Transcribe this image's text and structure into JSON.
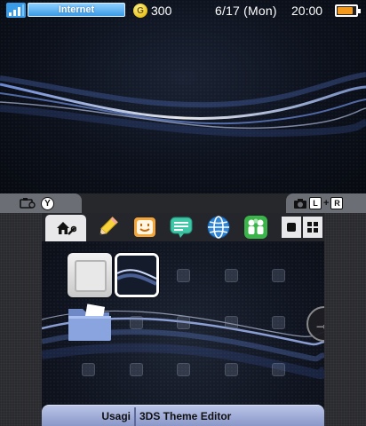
{
  "status_bar": {
    "network_label": "Internet",
    "coin_icon": "coin-icon",
    "coin_glyph": "G",
    "coin_count": "300",
    "date": "6/17 (Mon)",
    "time": "20:00",
    "battery_level": 0.85,
    "signal_strength": 3,
    "colors": {
      "network_pill": "#3a9be6",
      "battery": "#f39a1e"
    }
  },
  "shoulder_tabs": {
    "left": {
      "icons": [
        "camera-icon"
      ],
      "button": "Y"
    },
    "right": {
      "icons": [
        "camera-icon"
      ],
      "l": "L",
      "plus": "+",
      "r": "R"
    }
  },
  "toolbar": {
    "home_icon": "home-settings-icon",
    "apps": [
      {
        "name": "pencil-icon"
      },
      {
        "name": "face-icon"
      },
      {
        "name": "chat-bubble-icon"
      },
      {
        "name": "globe-icon"
      },
      {
        "name": "people-icon"
      }
    ],
    "view_buttons": [
      "square-view-icon",
      "grid-view-icon"
    ]
  },
  "grid": {
    "scroll_arrow": "→"
  },
  "bottom_bar": {
    "user": "Usagi",
    "title": "3DS Theme Editor",
    "color": "#9aa7d6"
  }
}
